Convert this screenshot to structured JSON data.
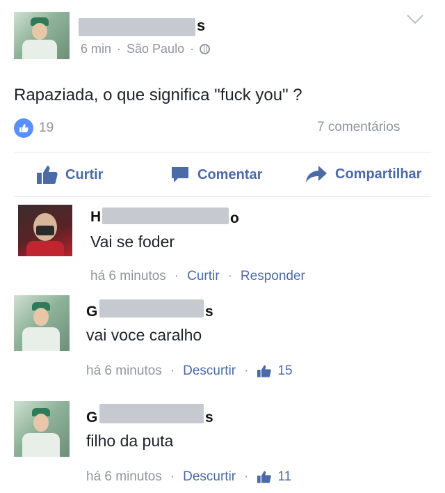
{
  "post": {
    "author_name_start": "",
    "author_name_end": "s",
    "time": "6 min",
    "location": "São Paulo",
    "text": "Rapaziada, o que significa \"fuck you\" ?",
    "reactions_count": "19",
    "comments_count": "7 comentários"
  },
  "actions": {
    "like": "Curtir",
    "comment": "Comentar",
    "share": "Compartilhar"
  },
  "comments": [
    {
      "name_start": "H",
      "name_end": "o",
      "text": "Vai se foder",
      "time": "há 6 minutos",
      "like_label": "Curtir",
      "reply_label": "Responder",
      "likes": ""
    },
    {
      "name_start": "G",
      "name_end": "s",
      "text": "vai voce caralho",
      "time": "há 6 minutos",
      "like_label": "Descurtir",
      "reply_label": "",
      "likes": "15"
    },
    {
      "name_start": "G",
      "name_end": "s",
      "text": "filho da puta",
      "time": "há 6 minutos",
      "like_label": "Descurtir",
      "reply_label": "",
      "likes": "11"
    }
  ],
  "colors": {
    "link": "#4b6aa8",
    "muted": "#90949c",
    "like_badge": "#5890ff"
  }
}
